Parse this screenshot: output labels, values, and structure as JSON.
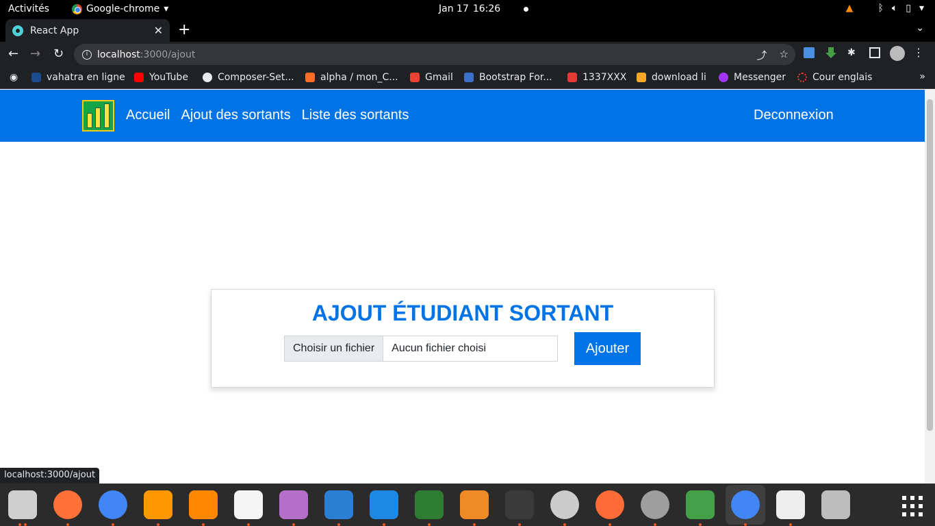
{
  "system": {
    "activities": "Activités",
    "app_menu": "Google-chrome",
    "date": "Jan 17",
    "time": "16:26"
  },
  "browser": {
    "tab_title": "React App",
    "url_host": "localhost",
    "url_path": ":3000/ajout",
    "status_url": "localhost:3000/ajout",
    "bookmarks": [
      {
        "label": "vahatra en ligne",
        "icon": "d-icon",
        "color": "#1a4b8c"
      },
      {
        "label": "YouTube",
        "icon": "youtube-icon",
        "color": "#ff0000"
      },
      {
        "label": "Composer-Set...",
        "icon": "globe-icon",
        "color": "#e8eaed"
      },
      {
        "label": "alpha / mon_C...",
        "icon": "gitlab-icon",
        "color": "#fc6d26"
      },
      {
        "label": "Gmail",
        "icon": "gmail-icon",
        "color": "#ea4335"
      },
      {
        "label": "Bootstrap For...",
        "icon": "mdb-icon",
        "color": "#3b71ca"
      },
      {
        "label": "1337XXX",
        "icon": "x-icon",
        "color": "#e53935"
      },
      {
        "label": "download li",
        "icon": "download-icon",
        "color": "#f9a825"
      },
      {
        "label": "Messenger",
        "icon": "messenger-icon",
        "color": "#a334fa"
      },
      {
        "label": "Cour englais",
        "icon": "ring-icon",
        "color": "#e53935"
      }
    ]
  },
  "nav": {
    "links": [
      "Accueil",
      "Ajout des sortants",
      "Liste des sortants"
    ],
    "logout": "Deconnexion"
  },
  "form": {
    "title": "AJOUT ÉTUDIANT SORTANT",
    "file_button": "Choisir un fichier",
    "file_status": "Aucun fichier choisi",
    "submit": "Ajouter"
  },
  "colors": {
    "primary": "#0073e6",
    "dock_bg": "#2b2b2b"
  },
  "dock": [
    {
      "name": "files-icon",
      "color": "#cfcfcf"
    },
    {
      "name": "firefox-icon",
      "color": "#ff7139"
    },
    {
      "name": "chrome-icon",
      "color": "#4285f4"
    },
    {
      "name": "sublime-icon",
      "color": "#ff9800"
    },
    {
      "name": "vlc-icon",
      "color": "#ff8800"
    },
    {
      "name": "text-editor-icon",
      "color": "#f5f5f5"
    },
    {
      "name": "video-icon",
      "color": "#b56fc9"
    },
    {
      "name": "document-viewer-icon",
      "color": "#2a7fd4"
    },
    {
      "name": "vscode-icon",
      "color": "#1e88e5"
    },
    {
      "name": "rocket-icon",
      "color": "#2e7d32"
    },
    {
      "name": "diagram-icon",
      "color": "#f08a24"
    },
    {
      "name": "terminal-icon",
      "color": "#3a3a3a"
    },
    {
      "name": "network-icon",
      "color": "#cccccc"
    },
    {
      "name": "postman-icon",
      "color": "#ff6c37"
    },
    {
      "name": "settings-icon",
      "color": "#9e9e9e"
    },
    {
      "name": "rocket-green-icon",
      "color": "#43a047"
    },
    {
      "name": "chrome-active-icon",
      "color": "#4285f4"
    },
    {
      "name": "text-viewer-icon",
      "color": "#eeeeee"
    },
    {
      "name": "disk-icon",
      "color": "#bdbdbd"
    }
  ]
}
